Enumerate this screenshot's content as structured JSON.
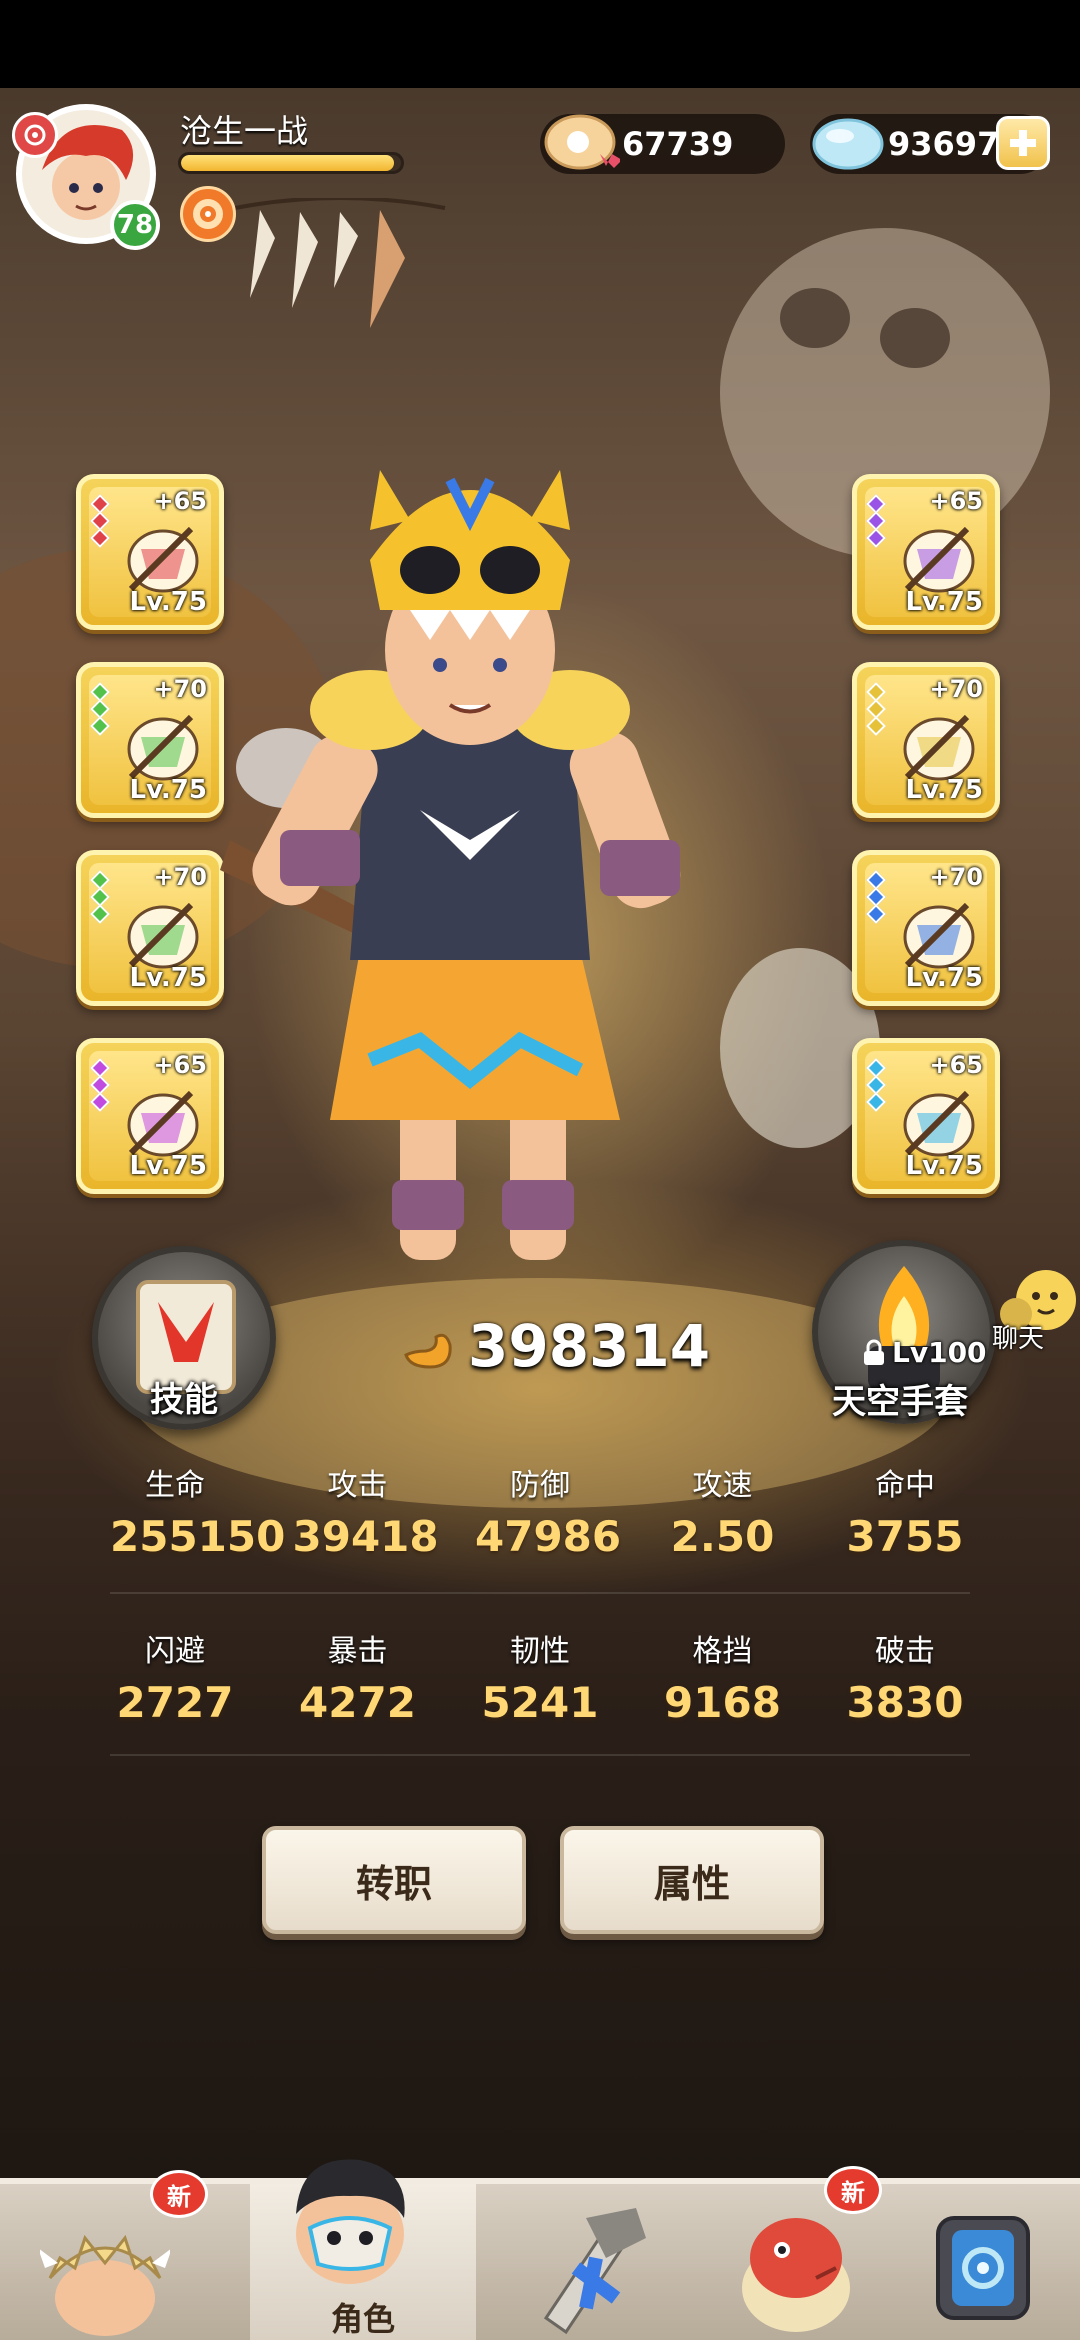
{
  "player": {
    "name": "沧生一战",
    "level": "78",
    "xp_fraction": 0.97
  },
  "currencies": {
    "shells": "67739",
    "gems": "936975"
  },
  "equipment": {
    "left": [
      {
        "plus": "+65",
        "level": "Lv.75",
        "gem_color": "#e0424a",
        "icon": "axe-icon"
      },
      {
        "plus": "+70",
        "level": "Lv.75",
        "gem_color": "#52c24a",
        "icon": "tiger-mask-icon"
      },
      {
        "plus": "+70",
        "level": "Lv.75",
        "gem_color": "#52c24a",
        "icon": "armor-icon"
      },
      {
        "plus": "+65",
        "level": "Lv.75",
        "gem_color": "#c14be0",
        "icon": "ring-icon"
      }
    ],
    "right": [
      {
        "plus": "+65",
        "level": "Lv.75",
        "gem_color": "#9a54e6",
        "icon": "claw-necklace-icon"
      },
      {
        "plus": "+70",
        "level": "Lv.75",
        "gem_color": "#e6c23a",
        "icon": "tiger-skirt-icon"
      },
      {
        "plus": "+70",
        "level": "Lv.75",
        "gem_color": "#3a7ae6",
        "icon": "leg-wrap-icon"
      },
      {
        "plus": "+65",
        "level": "Lv.75",
        "gem_color": "#3ab6e6",
        "icon": "bracelet-icon"
      }
    ]
  },
  "skill_button": {
    "label": "技能"
  },
  "gloves_button": {
    "label": "天空手套",
    "lock_level": "Lv100"
  },
  "chat": {
    "label": "聊天"
  },
  "power": "398314",
  "stats": {
    "row1": [
      {
        "label": "生命",
        "value": "255150"
      },
      {
        "label": "攻击",
        "value": "39418"
      },
      {
        "label": "防御",
        "value": "47986"
      },
      {
        "label": "攻速",
        "value": "2.50"
      },
      {
        "label": "命中",
        "value": "3755"
      }
    ],
    "row2": [
      {
        "label": "闪避",
        "value": "2727"
      },
      {
        "label": "暴击",
        "value": "4272"
      },
      {
        "label": "韧性",
        "value": "5241"
      },
      {
        "label": "格挡",
        "value": "9168"
      },
      {
        "label": "破击",
        "value": "3830"
      }
    ]
  },
  "actions": {
    "job_change": "转职",
    "attributes": "属性"
  },
  "nav": {
    "badge_new": "新",
    "tabs": [
      {
        "label": "",
        "icon": "tribe-chief-icon",
        "has_new": true
      },
      {
        "label": "角色",
        "icon": "character-icon",
        "has_new": false,
        "active": true
      },
      {
        "label": "",
        "icon": "weapon-icon",
        "has_new": false
      },
      {
        "label": "",
        "icon": "pet-dino-icon",
        "has_new": true
      },
      {
        "label": "",
        "icon": "portal-icon",
        "has_new": false
      }
    ]
  },
  "colors": {
    "stat_value": "#ffd774",
    "slot_gold": "#f0c240",
    "level_badge": "#3aa640",
    "new_badge": "#e53a2e"
  }
}
